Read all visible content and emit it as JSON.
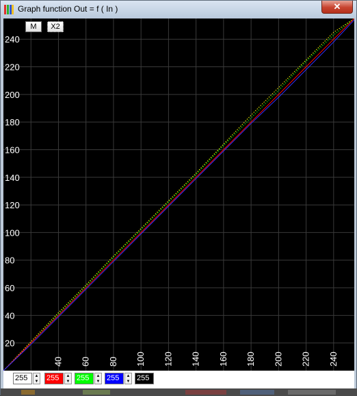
{
  "window": {
    "title": "Graph function Out = f ( In )",
    "close_label": "✕"
  },
  "toolbar": {
    "m_label": "M",
    "x2_label": "X2"
  },
  "chart_data": {
    "type": "line",
    "title": "",
    "xlabel": "",
    "ylabel": "",
    "xlim": [
      0,
      255
    ],
    "ylim": [
      0,
      255
    ],
    "grid": true,
    "x_ticks": [
      40,
      60,
      80,
      100,
      120,
      140,
      160,
      180,
      200,
      220,
      240
    ],
    "y_ticks": [
      20,
      40,
      60,
      80,
      100,
      120,
      140,
      160,
      180,
      200,
      220,
      240
    ],
    "series": [
      {
        "color": "#ffff00",
        "style": "dotted",
        "x": [
          0,
          20,
          40,
          60,
          80,
          100,
          120,
          140,
          160,
          180,
          200,
          220,
          240,
          255
        ],
        "y": [
          0,
          21,
          42,
          62,
          83,
          103,
          123,
          143,
          164,
          185,
          205,
          225,
          245,
          255
        ]
      },
      {
        "color": "#00ff00",
        "style": "dotted",
        "x": [
          0,
          20,
          40,
          60,
          80,
          100,
          120,
          140,
          160,
          180,
          200,
          220,
          240,
          255
        ],
        "y": [
          0,
          20,
          41,
          61,
          82,
          102,
          122,
          142,
          163,
          183,
          203,
          224,
          243,
          255
        ]
      },
      {
        "color": "#ff0000",
        "style": "solid",
        "x": [
          0,
          20,
          40,
          60,
          80,
          100,
          120,
          140,
          160,
          180,
          200,
          220,
          240,
          255
        ],
        "y": [
          0,
          20,
          40,
          60,
          80,
          100,
          120,
          140,
          160,
          180,
          200,
          220,
          240,
          255
        ]
      },
      {
        "color": "#3030ff",
        "style": "solid",
        "x": [
          0,
          20,
          40,
          60,
          80,
          100,
          120,
          140,
          160,
          180,
          200,
          220,
          240,
          255
        ],
        "y": [
          0,
          19,
          39,
          59,
          79,
          99,
          119,
          139,
          159,
          179,
          198,
          218,
          238,
          254
        ]
      }
    ]
  },
  "controls": {
    "all": "255",
    "red": "255",
    "green": "255",
    "blue": "255",
    "black": "255",
    "up_glyph": "▲",
    "down_glyph": "▼"
  },
  "colors": {
    "grid": "#3a3a3a",
    "axis_text": "#ffffff",
    "graph_bg": "#000000"
  }
}
